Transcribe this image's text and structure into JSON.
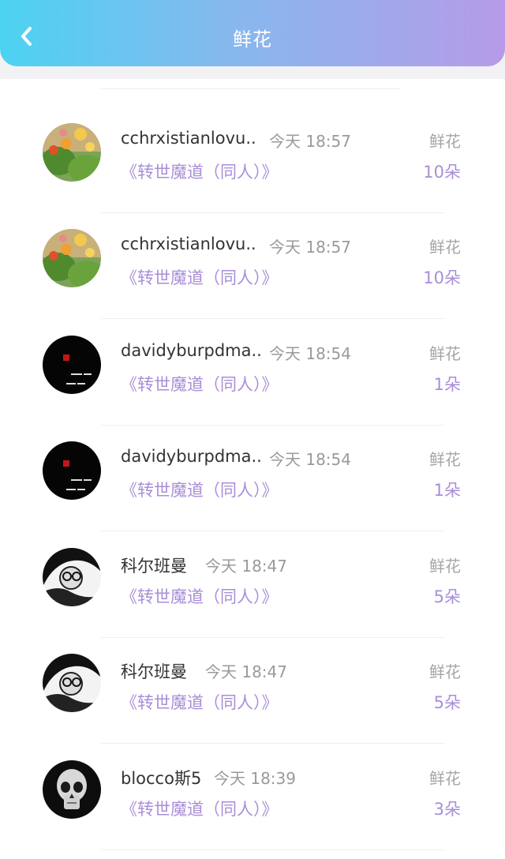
{
  "header": {
    "title": "鲜花",
    "back_icon": "chevron-left-icon"
  },
  "accent_color": "#a98ed8",
  "items": [
    {
      "name": "cchrxistianlovu..",
      "time": "今天 18:57",
      "book": "《转世魔道（同人）》",
      "gift": "鲜花",
      "count": "10朵",
      "avatar": "flowers"
    },
    {
      "name": "cchrxistianlovu..",
      "time": "今天 18:57",
      "book": "《转世魔道（同人）》",
      "gift": "鲜花",
      "count": "10朵",
      "avatar": "flowers"
    },
    {
      "name": "davidyburpdma..",
      "time": "今天 18:54",
      "book": "《转世魔道（同人）》",
      "gift": "鲜花",
      "count": "1朵",
      "avatar": "dark-text"
    },
    {
      "name": "davidyburpdma..",
      "time": "今天 18:54",
      "book": "《转世魔道（同人）》",
      "gift": "鲜花",
      "count": "1朵",
      "avatar": "dark-text"
    },
    {
      "name": "科尔班曼",
      "time": "今天 18:47",
      "book": "《转世魔道（同人）》",
      "gift": "鲜花",
      "count": "5朵",
      "avatar": "sketch-person"
    },
    {
      "name": "科尔班曼",
      "time": "今天 18:47",
      "book": "《转世魔道（同人）》",
      "gift": "鲜花",
      "count": "5朵",
      "avatar": "sketch-person"
    },
    {
      "name": "blocco斯5",
      "time": "今天 18:39",
      "book": "《转世魔道（同人）》",
      "gift": "鲜花",
      "count": "3朵",
      "avatar": "skull"
    }
  ]
}
